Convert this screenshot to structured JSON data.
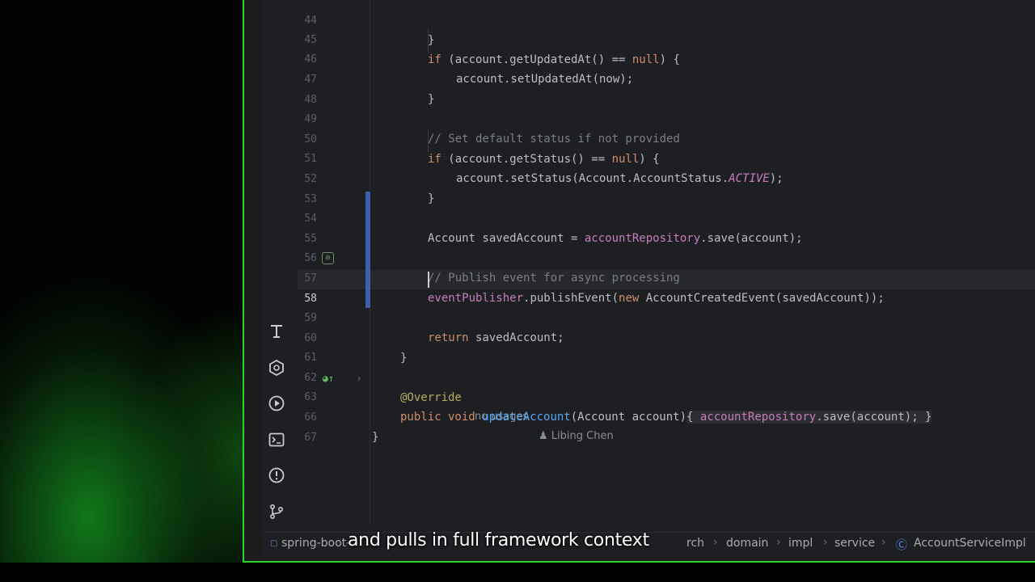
{
  "editor": {
    "lines": [
      {
        "num": "44"
      },
      {
        "num": "45"
      },
      {
        "num": "46"
      },
      {
        "num": "47"
      },
      {
        "num": "48"
      },
      {
        "num": "49"
      },
      {
        "num": "50"
      },
      {
        "num": "51"
      },
      {
        "num": "52"
      },
      {
        "num": "53"
      },
      {
        "num": "54"
      },
      {
        "num": "55"
      },
      {
        "num": "56"
      },
      {
        "num": "57"
      },
      {
        "num": "58"
      },
      {
        "num": "59"
      },
      {
        "num": "60"
      },
      {
        "num": "61"
      },
      {
        "num": "62"
      },
      {
        "num": "63"
      },
      {
        "num": "66"
      },
      {
        "num": "67"
      }
    ],
    "code": {
      "l44": "}",
      "l45_kw": "if",
      "l45_rest": " (account.getUpdatedAt() == ",
      "l45_null": "null",
      "l45_end": ") {",
      "l46": "account.setUpdatedAt(now);",
      "l47": "}",
      "l49": "// Set default status if not provided",
      "l50_kw": "if",
      "l50_rest": " (account.getStatus() == ",
      "l50_null": "null",
      "l50_end": ") {",
      "l51_pre": "account.setStatus(Account.AccountStatus.",
      "l51_const": "ACTIVE",
      "l51_end": ");",
      "l52": "}",
      "l54_pre": "Account savedAccount = ",
      "l54_fld": "accountRepository",
      "l54_end": ".save(account);",
      "l56": "// Publish event for async processing",
      "l57_fld": "eventPublisher",
      "l57_mid": ".publishEvent(",
      "l57_new": "new",
      "l57_end": " AccountCreatedEvent(savedAccount));",
      "l59_kw": "return",
      "l59_end": " savedAccount;",
      "l60": "}",
      "l62_ann": "@Override",
      "l62_usages": "no usages",
      "l62_author": "Libing Chen",
      "l63_kw": "public void ",
      "l63_fn": "updateAccount",
      "l63_params": "(Account account)",
      "l63_open": "{ ",
      "l63_fld": "accountRepository",
      "l63_call": ".save(account);",
      "l63_close": " }",
      "l66": "}"
    }
  },
  "toolstrip": {
    "icons": [
      "text-tool-icon",
      "plugin-icon",
      "run-icon",
      "terminal-icon",
      "problems-icon",
      "git-icon"
    ]
  },
  "statusbar": {
    "breadcrumbs": [
      "spring-boot-",
      "rch",
      "domain",
      "impl",
      "service",
      "AccountServiceImpl"
    ]
  },
  "subtitle": "and pulls in full framework context",
  "colors": {
    "accent_green": "#2fd12f",
    "keyword": "#cf8e6d",
    "field": "#c77dbb",
    "function": "#56a8f5",
    "comment": "#7a7e85",
    "annotation": "#b3ae60",
    "change_bar": "#3f5fa8"
  }
}
